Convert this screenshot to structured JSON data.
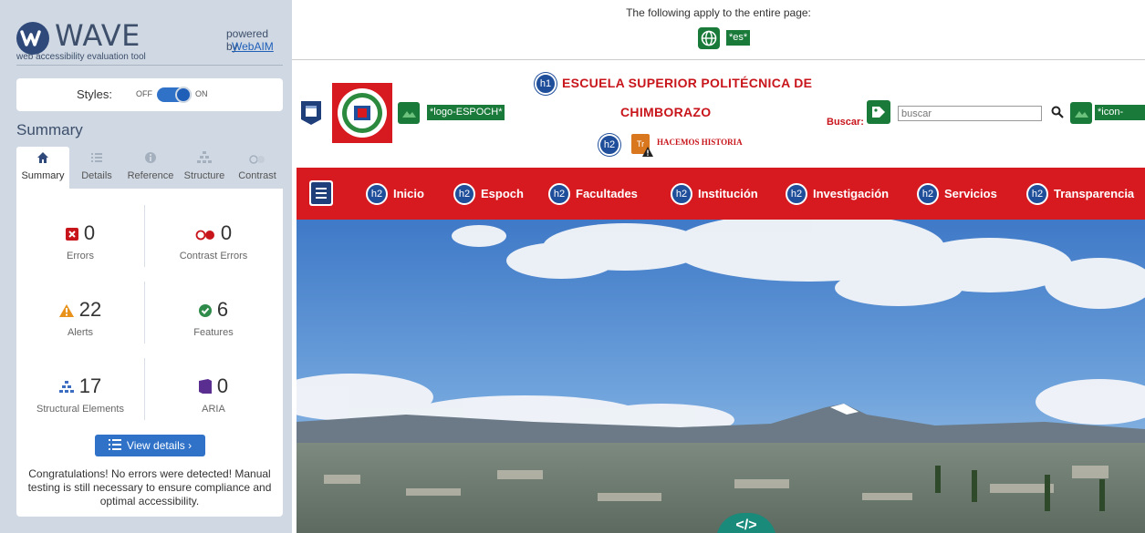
{
  "wave": {
    "logo_text": "WAVE",
    "tagline": "web accessibility evaluation tool",
    "powered_by": "powered by",
    "webaim_link": "WebAIM",
    "styles_label": "Styles:",
    "styles_off": "OFF",
    "styles_on": "ON",
    "summary_heading": "Summary",
    "tabs": [
      {
        "label": "Summary",
        "icon": "home-icon",
        "active": true
      },
      {
        "label": "Details",
        "icon": "list-icon",
        "active": false
      },
      {
        "label": "Reference",
        "icon": "info-icon",
        "active": false
      },
      {
        "label": "Structure",
        "icon": "structure-icon",
        "active": false
      },
      {
        "label": "Contrast",
        "icon": "contrast-icon",
        "active": false
      }
    ],
    "stats": {
      "errors": {
        "value": "0",
        "label": "Errors"
      },
      "contrast_errors": {
        "value": "0",
        "label": "Contrast Errors"
      },
      "alerts": {
        "value": "22",
        "label": "Alerts"
      },
      "features": {
        "value": "6",
        "label": "Features"
      },
      "structural": {
        "value": "17",
        "label": "Structural Elements"
      },
      "aria": {
        "value": "0",
        "label": "ARIA"
      }
    },
    "view_details": "View details ›",
    "congrats": "Congratulations! No errors were detected! Manual testing is still necessary to ensure compliance and optimal accessibility."
  },
  "page": {
    "applies_text": "The following apply to the entire page:",
    "lang_tag": "*es*",
    "logo_alt": "*logo-ESPOCH*",
    "h1_badge": "h1",
    "title_line1": "ESCUELA SUPERIOR POLITÉCNICA DE",
    "title_line2": "CHIMBORAZO",
    "h2_badge": "h2",
    "tr_badge": "Tr",
    "motto": "HACEMOS HISTORIA",
    "buscar_label": "Buscar:",
    "search_placeholder": "buscar",
    "icon_buscar_alt": "*icon-buscar",
    "nav": [
      "Inicio",
      "Espoch",
      "Facultades",
      "Institución",
      "Investigación",
      "Servicios",
      "Transparencia"
    ],
    "code_toggle": "</>"
  },
  "colors": {
    "wave_sidebar_bg": "#cfd8e3",
    "wave_blue": "#2f72c8",
    "feature_green": "#1a7a3a",
    "heading_badge_blue": "#1f4e9a",
    "espoch_red": "#d71920"
  }
}
